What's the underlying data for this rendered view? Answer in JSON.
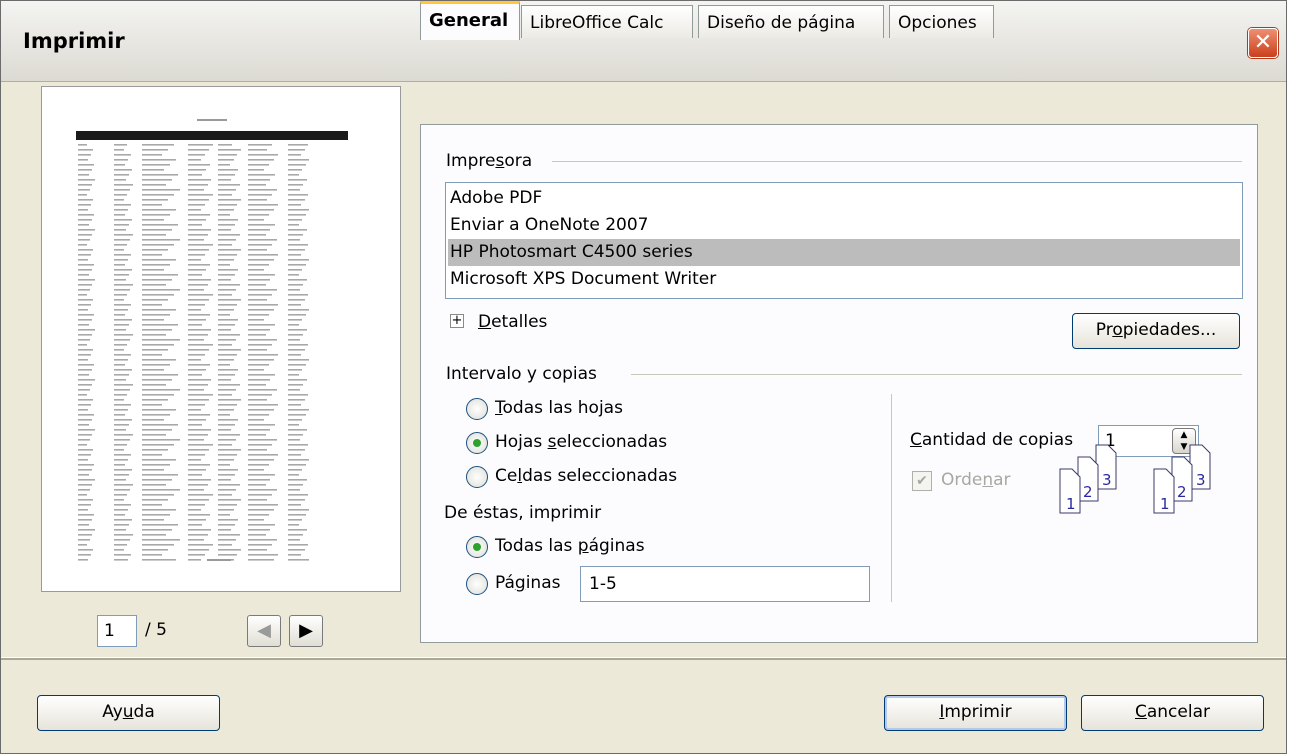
{
  "window": {
    "title": "Imprimir",
    "close_glyph": "✕"
  },
  "preview": {
    "current_page": "1",
    "total_label": "/ 5"
  },
  "tabs": [
    "General",
    "LibreOffice Calc",
    "Diseño de página",
    "Opciones"
  ],
  "printer": {
    "section_pre": "Impre",
    "section_u": "s",
    "section_post": "ora",
    "items": [
      "Adobe PDF",
      "Enviar a OneNote 2007",
      "HP Photosmart C4500 series",
      "Microsoft XPS Document Writer"
    ],
    "selected": "HP Photosmart C4500 series",
    "details_u": "D",
    "details_post": "etalles",
    "properties_pre": "Pr",
    "properties_u": "o",
    "properties_post": "piedades..."
  },
  "range": {
    "section": "Intervalo y copias",
    "all_sheets_u": "T",
    "all_sheets_post": "odas las hojas",
    "selected_sheets_pre": "Hojas ",
    "selected_sheets_u": "s",
    "selected_sheets_post": "eleccionadas",
    "selected_cells_pre": "Ce",
    "selected_cells_u": "l",
    "selected_cells_post": "das seleccionadas",
    "print_from": "De éstas, imprimir",
    "all_pages_pre": "Todas las ",
    "all_pages_u": "p",
    "all_pages_post": "áginas",
    "pages_pre": "Pá",
    "pages_u": "g",
    "pages_post": "inas",
    "pages_value": "1-5"
  },
  "copies": {
    "label_u": "C",
    "label_post": "antidad de copias",
    "value": "1",
    "collate_pre": "Orde",
    "collate_u": "n",
    "collate_post": "ar",
    "page_numbers": [
      "1",
      "2",
      "3"
    ]
  },
  "footer": {
    "help_pre": "Ay",
    "help_u": "u",
    "help_post": "da",
    "print_u": "I",
    "print_post": "mprimir",
    "cancel_u": "C",
    "cancel_post": "ancelar"
  },
  "colors": {
    "dialog_bg": "#ece9d8",
    "panel_bg": "#fcfcfe",
    "selected_row": "#bcbcbc",
    "radio_dot": "#2da32d",
    "close_button": "#d4582f",
    "tab_highlight": "#ffc83c"
  }
}
